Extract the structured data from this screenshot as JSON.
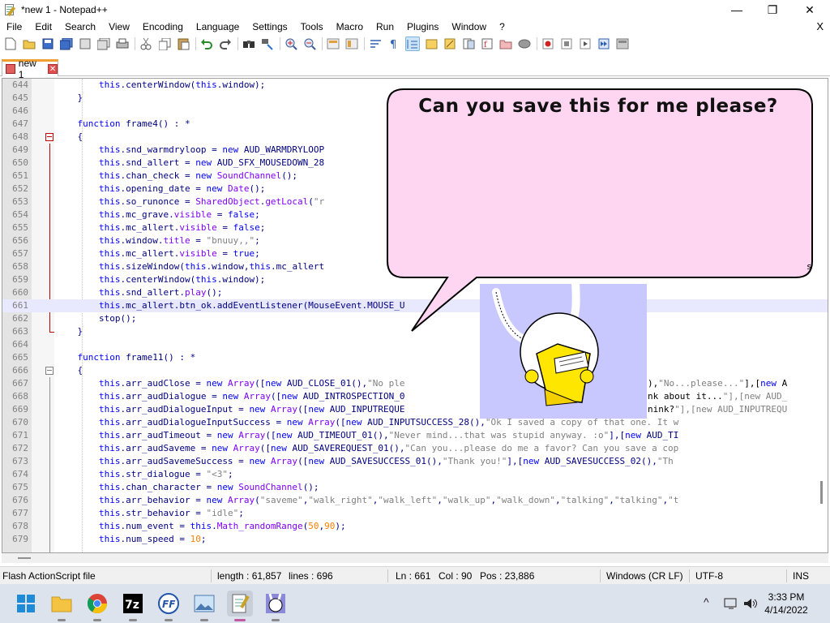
{
  "window": {
    "title": "*new 1 - Notepad++"
  },
  "window_controls": {
    "minimize": "—",
    "maximize": "❐",
    "close": "✕"
  },
  "menu": {
    "items": [
      "File",
      "Edit",
      "Search",
      "View",
      "Encoding",
      "Language",
      "Settings",
      "Tools",
      "Macro",
      "Run",
      "Plugins",
      "Window",
      "?"
    ],
    "close_doc": "X"
  },
  "toolbar": {
    "icons": [
      "new-file-icon",
      "open-file-icon",
      "save-icon",
      "save-all-icon",
      "close-icon",
      "close-all-icon",
      "print-icon",
      "cut-icon",
      "copy-icon",
      "paste-icon",
      "undo-icon",
      "redo-icon",
      "find-icon",
      "replace-icon",
      "zoom-in-icon",
      "zoom-out-icon",
      "sync-vertical-icon",
      "sync-horizontal-icon",
      "word-wrap-icon",
      "show-all-chars-icon",
      "indent-guide-icon",
      "udl-icon",
      "doc-map-icon",
      "doc-list-icon",
      "function-list-icon",
      "folder-workspace-icon",
      "monitoring-icon",
      "macro-record-icon",
      "macro-stop-icon",
      "macro-play-icon",
      "macro-run-multiple-icon",
      "macro-save-icon"
    ]
  },
  "tabs": [
    {
      "label": "new 1",
      "close": "✕"
    }
  ],
  "editor": {
    "current_line": 661,
    "lines": [
      {
        "n": "644",
        "t": "        this.centerWindow(this.window);"
      },
      {
        "n": "645",
        "t": "    }"
      },
      {
        "n": "646",
        "t": ""
      },
      {
        "n": "647",
        "t": "    function frame4() : *"
      },
      {
        "n": "648",
        "t": "    {"
      },
      {
        "n": "649",
        "t": "        this.snd_warmdryloop = new AUD_WARMDRYLOOP"
      },
      {
        "n": "650",
        "t": "        this.snd_allert = new AUD_SFX_MOUSEDOWN_28"
      },
      {
        "n": "651",
        "t": "        this.chan_check = new SoundChannel();"
      },
      {
        "n": "652",
        "t": "        this.opening_date = new Date();"
      },
      {
        "n": "653",
        "t": "        this.so_runonce = SharedObject.getLocal(\"r"
      },
      {
        "n": "654",
        "t": "        this.mc_grave.visible = false;"
      },
      {
        "n": "655",
        "t": "        this.mc_allert.visible = false;"
      },
      {
        "n": "656",
        "t": "        this.window.title = \"bnuuy,,\";"
      },
      {
        "n": "657",
        "t": "        this.mc_allert.visible = true;"
      },
      {
        "n": "658",
        "t": "        this.sizeWindow(this.window,this.mc_allert"
      },
      {
        "n": "659",
        "t": "        this.centerWindow(this.window);"
      },
      {
        "n": "660",
        "t": "        this.snd_allert.play();"
      },
      {
        "n": "661",
        "t": "        this.mc_allert.btn_ok.addEventListener(MouseEvent.MOUSE_U"
      },
      {
        "n": "662",
        "t": "        stop();"
      },
      {
        "n": "663",
        "t": "    }"
      },
      {
        "n": "664",
        "t": ""
      },
      {
        "n": "665",
        "t": "    function frame11() : *"
      },
      {
        "n": "666",
        "t": "    {"
      },
      {
        "n": "667",
        "t": "        this.arr_audClose = new Array([new AUD_CLOSE_01(),\"No ple"
      },
      {
        "n": "668",
        "t": "        this.arr_audDialogue = new Array([new AUD_INTROSPECTION_0"
      },
      {
        "n": "669",
        "t": "        this.arr_audDialogueInput = new Array([new AUD_INPUTREQUE"
      },
      {
        "n": "670",
        "t": "        this.arr_audDialogueInputSuccess = new Array([new AUD_INPUTSUCCESS_28(),\"Ok I saved a copy of that one. It w"
      },
      {
        "n": "671",
        "t": "        this.arr_audTimeout = new Array([new AUD_TIMEOUT_01(),\"Never mind...that was stupid anyway. :o\"],[new AUD_TI"
      },
      {
        "n": "672",
        "t": "        this.arr_audSaveme = new Array([new AUD_SAVEREQUEST_01(),\"Can you...please do me a favor? Can you save a cop"
      },
      {
        "n": "673",
        "t": "        this.arr_audSavemeSuccess = new Array([new AUD_SAVESUCCESS_01(),\"Thank you!\"],[new AUD_SAVESUCCESS_02(),\"Th"
      },
      {
        "n": "674",
        "t": "        this.str_dialogue = \"<3\";"
      },
      {
        "n": "675",
        "t": "        this.chan_character = new SoundChannel();"
      },
      {
        "n": "676",
        "t": "        this.arr_behavior = new Array(\"saveme\",\"walk_right\",\"walk_left\",\"walk_up\",\"walk_down\",\"talking\",\"talking\",\"t"
      },
      {
        "n": "677",
        "t": "        this.str_behavior = \"idle\";"
      },
      {
        "n": "678",
        "t": "        this.num_event = this.Math_randomRange(50,90);"
      },
      {
        "n": "679",
        "t": "        this.num_speed = 10;"
      }
    ],
    "overflow_fragments": {
      "658": "s",
      "667a": "),\"No...please...\"],[new A",
      "668a": "nk about it...\"],[new AUD_",
      "669a": "nink?\"],[new AUD_INPUTREQU"
    }
  },
  "overlay": {
    "speech": "Can you save this for me please?",
    "bubble_color": "#ffd6f2",
    "panel_color": "#c8c8ff"
  },
  "status": {
    "file_type": "Flash ActionScript file",
    "length": "length : 61,857",
    "lines": "lines : 696",
    "ln": "Ln : 661",
    "col": "Col : 90",
    "pos": "Pos : 23,886",
    "eol": "Windows (CR LF)",
    "encoding": "UTF-8",
    "mode": "INS"
  },
  "taskbar": {
    "apps": [
      "windows-start-icon",
      "file-explorer-icon",
      "chrome-icon",
      "7zip-icon",
      "flash-decompiler-icon",
      "photos-icon",
      "notepad-plus-plus-icon",
      "bunny-app-icon"
    ],
    "tray_chevron": "^",
    "time": "3:33 PM",
    "date": "4/14/2022"
  },
  "colors": {
    "keyword": "#0000ff",
    "string": "#808080",
    "number": "#ff8000",
    "class": "#8000ff",
    "default": "#000080",
    "current_line": "#e8e8ff"
  }
}
